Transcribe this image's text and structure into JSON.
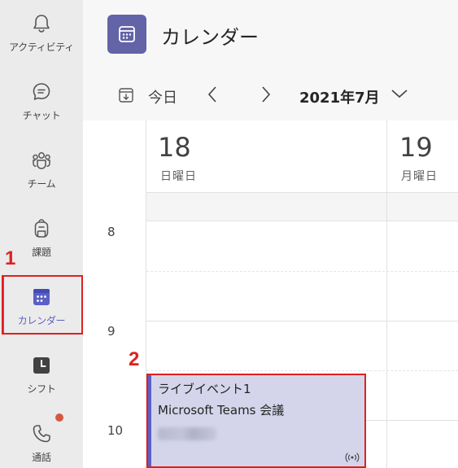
{
  "rail": {
    "items": [
      {
        "label": "アクティビティ",
        "icon": "bell-icon"
      },
      {
        "label": "チャット",
        "icon": "chat-icon"
      },
      {
        "label": "チーム",
        "icon": "teams-icon"
      },
      {
        "label": "課題",
        "icon": "backpack-icon"
      },
      {
        "label": "カレンダー",
        "icon": "calendar-icon",
        "active": true
      },
      {
        "label": "シフト",
        "icon": "shifts-clock-icon"
      },
      {
        "label": "通話",
        "icon": "phone-icon",
        "badge": true
      }
    ]
  },
  "header": {
    "title": "カレンダー",
    "icon": "calendar-icon"
  },
  "toolbar": {
    "today": "今日",
    "month": "2021年7月"
  },
  "days": [
    {
      "num": "18",
      "name": "日曜日"
    },
    {
      "num": "19",
      "name": "月曜日"
    }
  ],
  "hours": [
    "8",
    "9",
    "10"
  ],
  "event": {
    "title": "ライブイベント1",
    "description": "Microsoft Teams 会議",
    "icon": "live-broadcast-icon"
  },
  "annotations": {
    "step1": "1",
    "step2": "2"
  },
  "colors": {
    "accent": "#5b5fc7",
    "highlight": "#e02020",
    "event_bg": "#d4d5ea"
  }
}
